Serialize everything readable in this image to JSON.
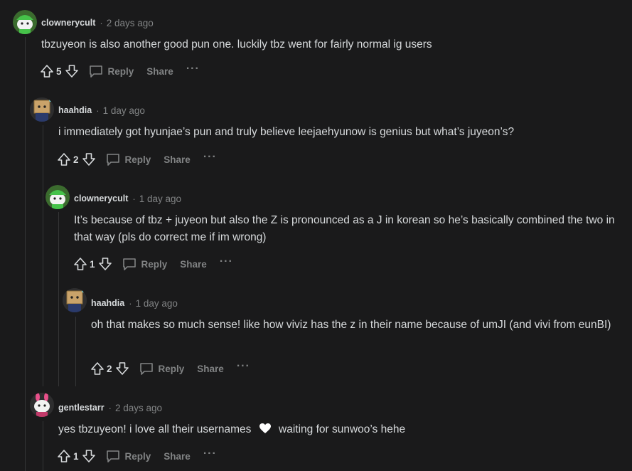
{
  "comments": [
    {
      "author": "clownerycult",
      "time": "2 days ago",
      "body": "tbzuyeon is also another good pun one. luckily tbz went for fairly normal ig users",
      "score": "5",
      "reply_label": "Reply",
      "share_label": "Share",
      "avatar_icon": "green-snoo-avatar"
    },
    {
      "author": "haahdia",
      "time": "1 day ago",
      "body": "i immediately got hyunjae’s pun and truly believe leejaehyunow is genius but what’s juyeon’s?",
      "score": "2",
      "reply_label": "Reply",
      "share_label": "Share",
      "avatar_icon": "box-head-snoo-avatar"
    },
    {
      "author": "clownerycult",
      "time": "1 day ago",
      "body": "It’s because of tbz + juyeon but also the Z is pronounced as a J in korean so he’s basically combined the two in that way (pls do correct me if im wrong)",
      "score": "1",
      "reply_label": "Reply",
      "share_label": "Share",
      "avatar_icon": "green-snoo-avatar"
    },
    {
      "author": "haahdia",
      "time": "1 day ago",
      "body": "oh that makes so much sense! like how viviz has the z in their name because of umJI (and vivi from eunBI)",
      "score": "2",
      "reply_label": "Reply",
      "share_label": "Share",
      "avatar_icon": "box-head-snoo-avatar"
    },
    {
      "author": "gentlestarr",
      "time": "2 days ago",
      "body_before": "yes tbzuyeon! i love all their usernames",
      "body_after": "waiting for sunwoo’s hehe",
      "score": "1",
      "reply_label": "Reply",
      "share_label": "Share",
      "avatar_icon": "bunny-snoo-avatar",
      "emoji": "white-heart-icon"
    }
  ],
  "colors": {
    "background": "#1a1a1b",
    "text": "#d7dadc",
    "muted": "#818384",
    "thread_line": "#343536"
  }
}
